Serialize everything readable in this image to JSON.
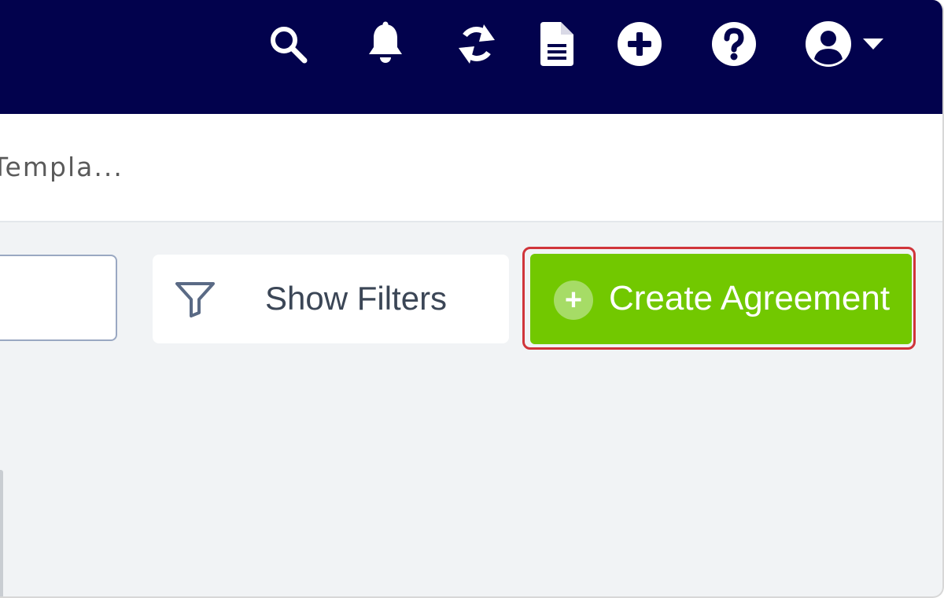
{
  "header": {
    "icons": [
      "search-icon",
      "bell-icon",
      "sync-icon",
      "document-icon",
      "add-circle-icon",
      "help-icon",
      "user-avatar-icon",
      "caret-down-icon"
    ]
  },
  "breadcrumb": {
    "text": "Templa..."
  },
  "toolbar": {
    "search_value": "",
    "show_filters_label": "Show Filters",
    "create_label": "Create Agreement",
    "create_plus": "+"
  },
  "colors": {
    "header_bg": "#02024d",
    "create_bg": "#72c800",
    "highlight": "#d0343a",
    "page_bg": "#f1f3f5"
  }
}
